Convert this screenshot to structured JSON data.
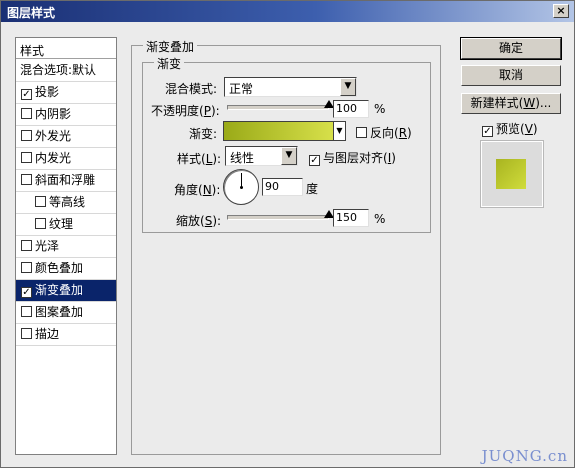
{
  "window": {
    "title": "图层样式",
    "close_symbol": "×"
  },
  "style_list": {
    "header": "样式",
    "items": [
      {
        "label": "混合选项:默认",
        "checkbox": false,
        "checked": false,
        "indent": false,
        "selected": false
      },
      {
        "label": "投影",
        "checkbox": true,
        "checked": true,
        "indent": false,
        "selected": false
      },
      {
        "label": "内阴影",
        "checkbox": true,
        "checked": false,
        "indent": false,
        "selected": false
      },
      {
        "label": "外发光",
        "checkbox": true,
        "checked": false,
        "indent": false,
        "selected": false
      },
      {
        "label": "内发光",
        "checkbox": true,
        "checked": false,
        "indent": false,
        "selected": false
      },
      {
        "label": "斜面和浮雕",
        "checkbox": true,
        "checked": false,
        "indent": false,
        "selected": false
      },
      {
        "label": "等高线",
        "checkbox": true,
        "checked": false,
        "indent": true,
        "selected": false
      },
      {
        "label": "纹理",
        "checkbox": true,
        "checked": false,
        "indent": true,
        "selected": false
      },
      {
        "label": "光泽",
        "checkbox": true,
        "checked": false,
        "indent": false,
        "selected": false
      },
      {
        "label": "颜色叠加",
        "checkbox": true,
        "checked": false,
        "indent": false,
        "selected": false
      },
      {
        "label": "渐变叠加",
        "checkbox": true,
        "checked": true,
        "indent": false,
        "selected": true
      },
      {
        "label": "图案叠加",
        "checkbox": true,
        "checked": false,
        "indent": false,
        "selected": false
      },
      {
        "label": "描边",
        "checkbox": true,
        "checked": false,
        "indent": false,
        "selected": false
      }
    ]
  },
  "panel": {
    "outer_title": "渐变叠加",
    "inner_title": "渐变",
    "blend_mode": {
      "label": "混合模式:",
      "value": "正常"
    },
    "opacity": {
      "label_pre": "不透明度(",
      "key": "P",
      "label_post": "):",
      "value": "100",
      "unit": "%",
      "level": 100
    },
    "gradient": {
      "label": "渐变:",
      "reverse_label_pre": "反向(",
      "reverse_key": "R",
      "reverse_label_post": ")",
      "reverse_checked": false,
      "color_start": "#9aaa18",
      "color_end": "#d7e04a"
    },
    "style": {
      "label_pre": "样式(",
      "key": "L",
      "label_post": "):",
      "value": "线性",
      "align_label_pre": "与图层对齐(",
      "align_key": "I",
      "align_label_post": ")",
      "align_checked": true
    },
    "angle": {
      "label_pre": "角度(",
      "key": "N",
      "label_post": "):",
      "value": "90",
      "unit": "度"
    },
    "scale": {
      "label_pre": "缩放(",
      "key": "S",
      "label_post": "):",
      "value": "150",
      "unit": "%",
      "level": 150
    }
  },
  "buttons": {
    "ok": "确定",
    "cancel": "取消",
    "new_style_pre": "新建样式(",
    "new_style_key": "W",
    "new_style_post": ")...",
    "preview_pre": "预览(",
    "preview_key": "V",
    "preview_post": ")",
    "preview_checked": true
  },
  "watermark": "JUQNG.cn",
  "check_symbol": "✓",
  "arrow_symbol": "▼"
}
